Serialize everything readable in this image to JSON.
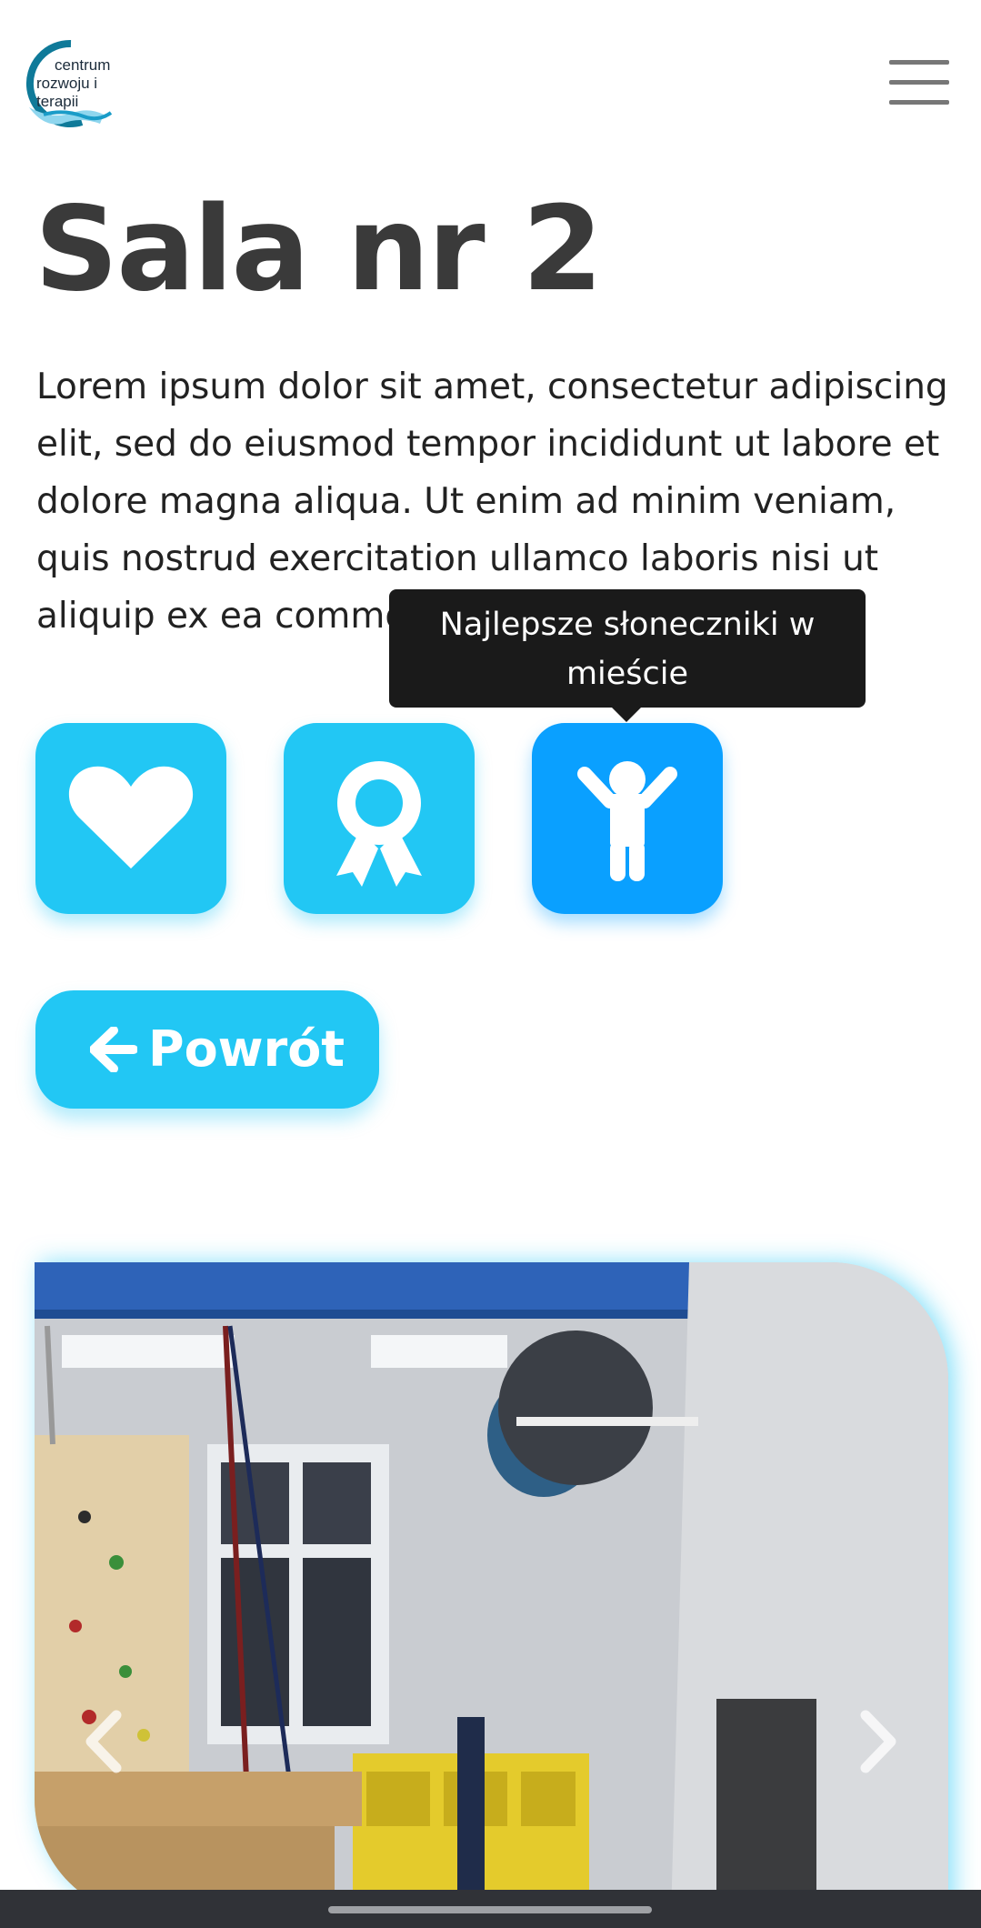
{
  "header": {
    "logo_line1": "centrum",
    "logo_line2": "rozwoju i terapii",
    "menu_icon": "hamburger-menu-icon"
  },
  "page": {
    "title": "Sala nr 2",
    "description": "Lorem ipsum dolor sit amet, consectetur adipiscing elit, sed do eiusmod tempor incididunt ut labore et dolore magna aliqua. Ut enim ad minim veniam, quis nostrud exercitation ullamco laboris nisi ut aliquip ex ea commodo consequat."
  },
  "features": {
    "tooltip": "Najlepsze słoneczniki w mieście",
    "items": [
      {
        "icon": "heart-icon",
        "active": false
      },
      {
        "icon": "award-ribbon-icon",
        "active": false
      },
      {
        "icon": "child-icon",
        "active": true
      }
    ]
  },
  "back_button": {
    "label": "Powrót",
    "icon": "arrow-left-icon"
  },
  "carousel": {
    "prev_icon": "chevron-left-icon",
    "next_icon": "chevron-right-icon"
  },
  "colors": {
    "accent": "#22c7f4",
    "accent_active": "#0aa0ff",
    "title": "#3a3a3a",
    "tooltip_bg": "#1a1a1a"
  }
}
